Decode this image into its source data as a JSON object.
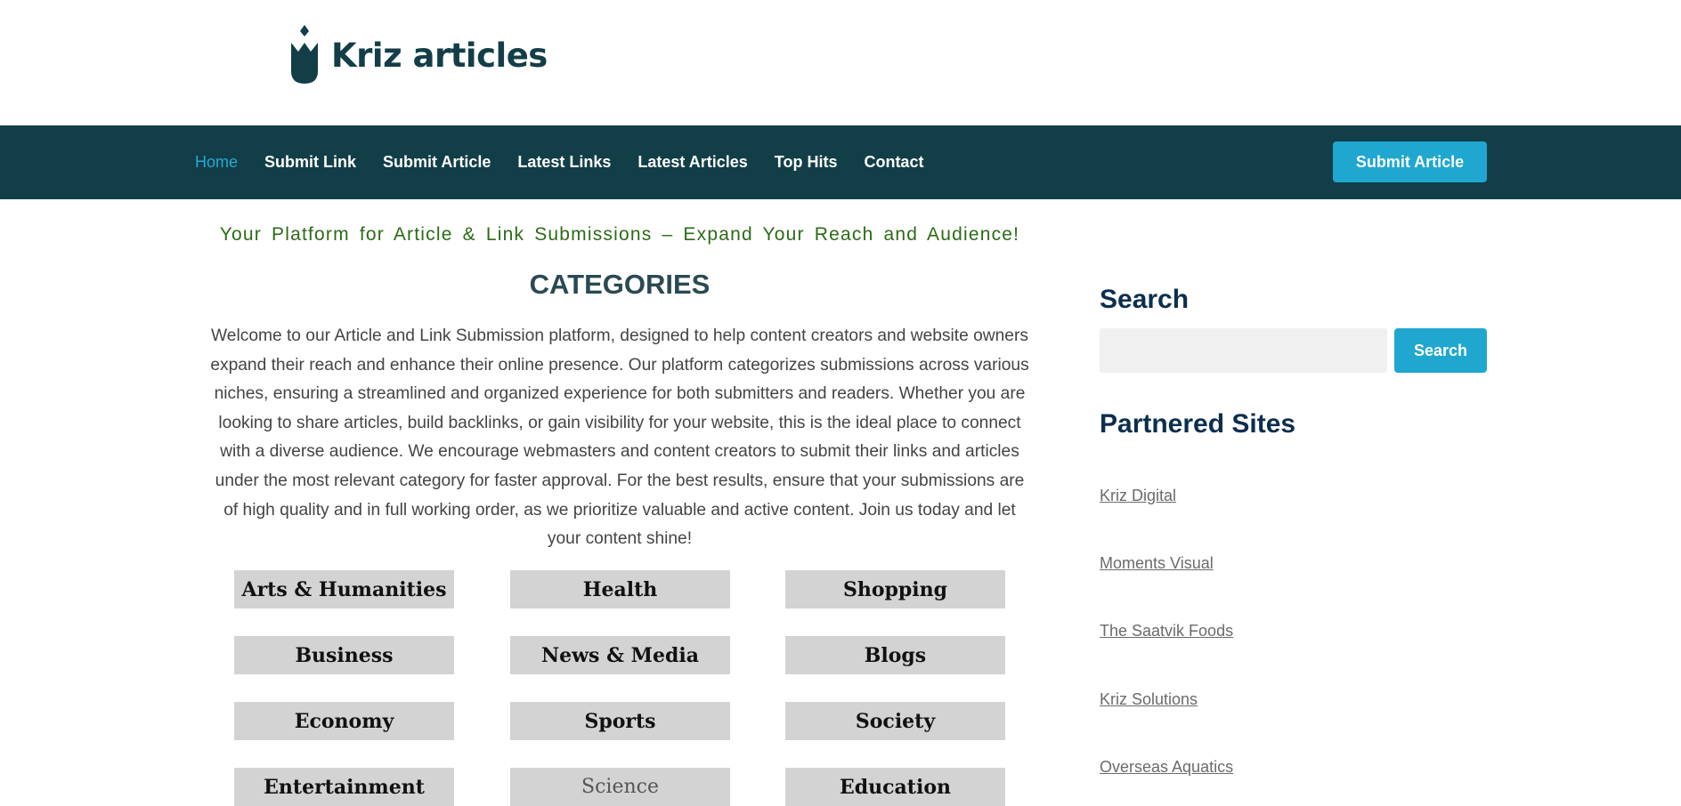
{
  "header": {
    "logo_text": "Kriz articles",
    "logo_icon": "tulip-logo-icon"
  },
  "nav": {
    "items": [
      {
        "label": "Home",
        "active": true
      },
      {
        "label": "Submit Link",
        "active": false
      },
      {
        "label": "Submit Article",
        "active": false
      },
      {
        "label": "Latest Links",
        "active": false
      },
      {
        "label": "Latest Articles",
        "active": false
      },
      {
        "label": "Top Hits",
        "active": false
      },
      {
        "label": "Contact",
        "active": false
      }
    ],
    "cta_label": "Submit Article"
  },
  "main": {
    "tagline": "Your Platform for Article & Link Submissions – Expand Your Reach and Audience!",
    "heading": "CATEGORIES",
    "intro": "Welcome to our Article and Link Submission platform, designed to help content creators and website owners expand their reach and enhance their online presence. Our platform categorizes submissions across various niches, ensuring a streamlined and organized experience for both submitters and readers. Whether you are looking to share articles, build backlinks, or gain visibility for your website, this is the ideal place to connect with a diverse audience. We encourage webmasters and content creators to submit their links and articles under the most relevant category for faster approval. For the best results, ensure that your submissions are of high quality and in full working order, as we prioritize valuable and active content. Join us today and let your content shine!",
    "categories": [
      "Arts & Humanities",
      "Health",
      "Shopping",
      "Business",
      "News & Media",
      "Blogs",
      "Economy",
      "Sports",
      "Society",
      "Entertainment",
      "Science",
      "Education"
    ]
  },
  "sidebar": {
    "search_heading": "Search",
    "search_placeholder": "",
    "search_button": "Search",
    "partners_heading": "Partnered Sites",
    "partners": [
      "Kriz Digital",
      "Moments Visual",
      "The Saatvik Foods",
      "Kriz Solutions",
      "Overseas Aquatics"
    ]
  },
  "colors": {
    "nav_bg": "#123e48",
    "accent": "#1fa7cf",
    "brand": "#133e48",
    "tagline": "#2c6b16"
  }
}
